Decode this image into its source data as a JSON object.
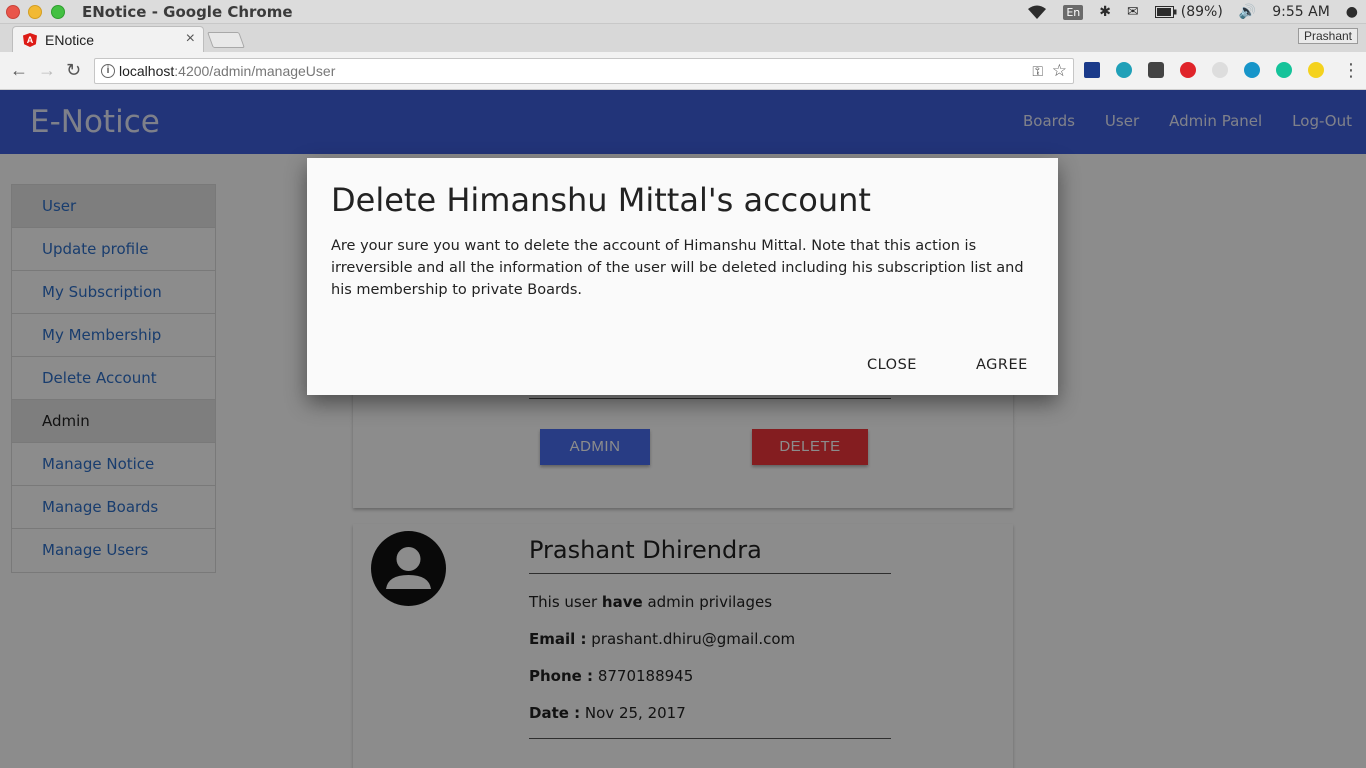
{
  "os": {
    "window_title": "ENotice - Google Chrome",
    "lang": "En",
    "battery": "(89%)",
    "time": "9:55 AM"
  },
  "browser": {
    "tab_title": "ENotice",
    "tab_close": "×",
    "profile": "Prashant",
    "url_host": "localhost",
    "url_path": ":4200/admin/manageUser",
    "back": "←",
    "forward": "→",
    "reload": "↻",
    "info": "i",
    "key": "⚿",
    "star": "☆",
    "menu": "⋮"
  },
  "app": {
    "brand": "E-Notice",
    "nav": [
      "Boards",
      "User",
      "Admin Panel",
      "Log-Out"
    ],
    "sidebar": [
      {
        "label": "User",
        "type": "header"
      },
      {
        "label": "Update profile",
        "type": "link"
      },
      {
        "label": "My Subscription",
        "type": "link"
      },
      {
        "label": "My Membership",
        "type": "link"
      },
      {
        "label": "Delete Account",
        "type": "link"
      },
      {
        "label": "Admin",
        "type": "header-dark"
      },
      {
        "label": "Manage Notice",
        "type": "link"
      },
      {
        "label": "Manage Boards",
        "type": "link"
      },
      {
        "label": "Manage Users",
        "type": "link"
      }
    ],
    "card1": {
      "admin_button": "ADMIN",
      "delete_button": "DELETE"
    },
    "card2": {
      "name": "Prashant Dhirendra",
      "privilege_prefix": "This user ",
      "privilege_bold": "have",
      "privilege_suffix": " admin privilages",
      "email_label": "Email :",
      "email": " prashant.dhiru@gmail.com",
      "phone_label": "Phone :",
      "phone": " 8770188945",
      "date_label": "Date :",
      "date": " Nov 25, 2017"
    }
  },
  "modal": {
    "title": "Delete Himanshu Mittal's account",
    "body": "Are your sure you want to delete the account of Himanshu Mittal. Note that this action is irreversible and all the information of the user will be deleted including his subscription list and his membership to private Boards.",
    "close": "CLOSE",
    "agree": "AGREE"
  }
}
